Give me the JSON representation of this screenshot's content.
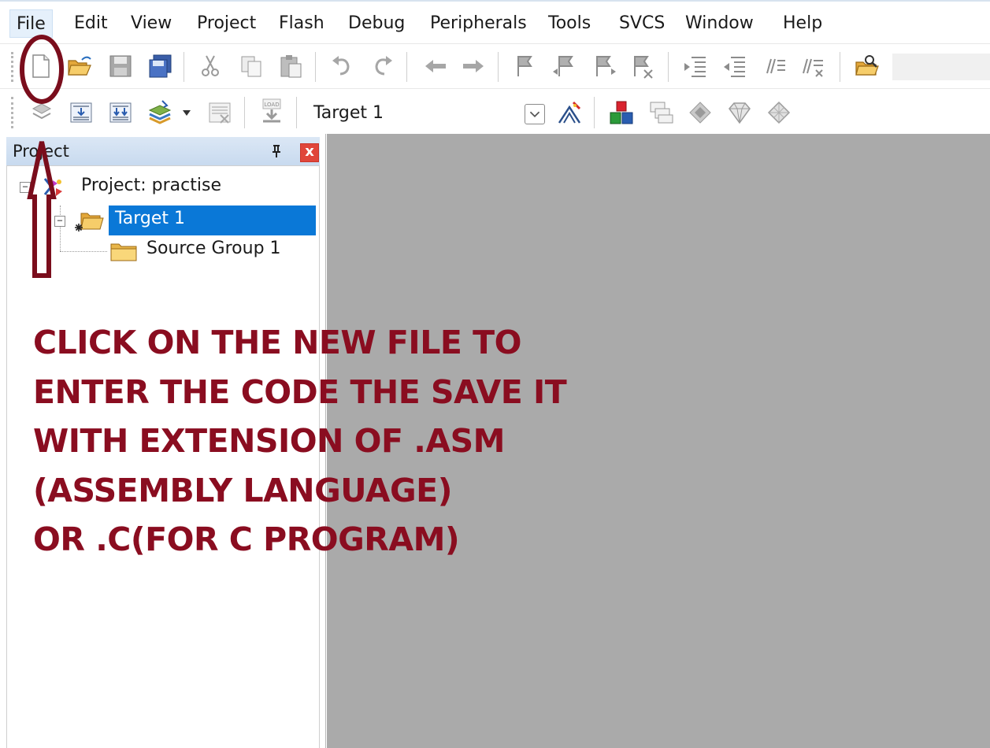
{
  "menu": {
    "items": [
      "File",
      "Edit",
      "View",
      "Project",
      "Flash",
      "Debug",
      "Peripherals",
      "Tools",
      "SVCS",
      "Window",
      "Help"
    ],
    "active_index": 0
  },
  "toolbar2": {
    "target_select": "Target 1"
  },
  "project_panel": {
    "title": "Project",
    "close_glyph": "x",
    "tree": {
      "project": "Project: practise",
      "target": "Target 1",
      "group": "Source Group 1"
    }
  },
  "annotation": {
    "lines": [
      "CLICK ON THE NEW FILE TO",
      "ENTER THE CODE THE SAVE IT",
      "WITH EXTENSION OF .ASM",
      "(ASSEMBLY LANGUAGE)",
      "OR .C(FOR C PROGRAM)"
    ],
    "color": "#8a0d20"
  },
  "icons": {
    "toolbar1": [
      "new-file-icon",
      "open-file-icon",
      "save-icon",
      "save-all-icon",
      "cut-icon",
      "copy-icon",
      "paste-icon",
      "undo-icon",
      "redo-icon",
      "navigate-back-icon",
      "navigate-forward-icon",
      "insert-bookmark-icon",
      "previous-bookmark-icon",
      "next-bookmark-icon",
      "clear-bookmarks-icon",
      "indent-icon",
      "unindent-icon",
      "comment-icon",
      "uncomment-icon",
      "find-in-files-icon"
    ],
    "toolbar2": [
      "translate-icon",
      "build-icon",
      "rebuild-icon",
      "batch-build-icon",
      "stop-build-icon",
      "download-icon",
      "options-for-target-icon",
      "manage-components-icon",
      "manage-environment-icon",
      "select-packs-icon",
      "pack-installer-icon",
      "manage-rte-icon"
    ]
  }
}
